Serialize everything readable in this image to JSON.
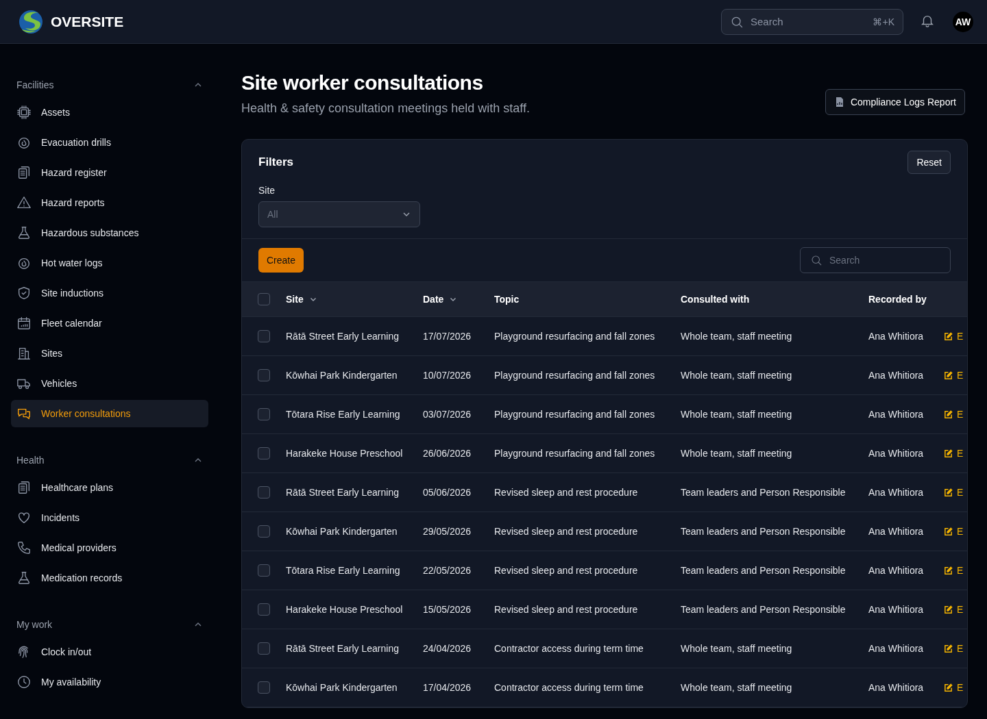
{
  "header": {
    "brand": "OVERSITE",
    "search": {
      "placeholder": "Search",
      "shortcut": "⌘+K"
    },
    "avatar": "AW"
  },
  "sidebar": [
    {
      "title": "Facilities",
      "expanded": true,
      "items": [
        {
          "label": "Assets",
          "selected": false
        },
        {
          "label": "Evacuation drills",
          "selected": false
        },
        {
          "label": "Hazard register",
          "selected": false
        },
        {
          "label": "Hazard reports",
          "selected": false
        },
        {
          "label": "Hazardous substances",
          "selected": false
        },
        {
          "label": "Hot water logs",
          "selected": false
        },
        {
          "label": "Site inductions",
          "selected": false
        },
        {
          "label": "Fleet calendar",
          "selected": false
        },
        {
          "label": "Sites",
          "selected": false
        },
        {
          "label": "Vehicles",
          "selected": false
        },
        {
          "label": "Worker consultations",
          "selected": true
        }
      ]
    },
    {
      "title": "Health",
      "expanded": true,
      "items": [
        {
          "label": "Healthcare plans",
          "selected": false
        },
        {
          "label": "Incidents",
          "selected": false
        },
        {
          "label": "Medical providers",
          "selected": false
        },
        {
          "label": "Medication records",
          "selected": false
        }
      ]
    },
    {
      "title": "My work",
      "expanded": true,
      "items": [
        {
          "label": "Clock in/out",
          "selected": false
        },
        {
          "label": "My availability",
          "selected": false
        }
      ]
    }
  ],
  "page": {
    "title": "Site worker consultations",
    "subtitle": "Health & safety consultation meetings held with staff.",
    "report_button": "Compliance Logs Report"
  },
  "filters": {
    "title": "Filters",
    "reset": "Reset",
    "site_label": "Site",
    "site_value": "All"
  },
  "create_button": "Create",
  "table_search": {
    "placeholder": "Search"
  },
  "table": {
    "select_all_checked": false,
    "columns": [
      {
        "label": "Site",
        "sortable": true
      },
      {
        "label": "Date",
        "sortable": true
      },
      {
        "label": "Topic",
        "sortable": false
      },
      {
        "label": "Consulted with",
        "sortable": false
      },
      {
        "label": "Recorded by",
        "sortable": false
      }
    ],
    "rows": [
      {
        "checked": false,
        "site": "Rātā Street Early Learning",
        "date": "17/07/2026",
        "topic": "Playground resurfacing and fall zones",
        "consulted": "Whole team, staff meeting",
        "recorded_by": "Ana Whitiora",
        "action": "E"
      },
      {
        "checked": false,
        "site": "Kōwhai Park Kindergarten",
        "date": "10/07/2026",
        "topic": "Playground resurfacing and fall zones",
        "consulted": "Whole team, staff meeting",
        "recorded_by": "Ana Whitiora",
        "action": "E"
      },
      {
        "checked": false,
        "site": "Tōtara Rise Early Learning",
        "date": "03/07/2026",
        "topic": "Playground resurfacing and fall zones",
        "consulted": "Whole team, staff meeting",
        "recorded_by": "Ana Whitiora",
        "action": "E"
      },
      {
        "checked": false,
        "site": "Harakeke House Preschool",
        "date": "26/06/2026",
        "topic": "Playground resurfacing and fall zones",
        "consulted": "Whole team, staff meeting",
        "recorded_by": "Ana Whitiora",
        "action": "E"
      },
      {
        "checked": false,
        "site": "Rātā Street Early Learning",
        "date": "05/06/2026",
        "topic": "Revised sleep and rest procedure",
        "consulted": "Team leaders and Person Responsible",
        "recorded_by": "Ana Whitiora",
        "action": "E"
      },
      {
        "checked": false,
        "site": "Kōwhai Park Kindergarten",
        "date": "29/05/2026",
        "topic": "Revised sleep and rest procedure",
        "consulted": "Team leaders and Person Responsible",
        "recorded_by": "Ana Whitiora",
        "action": "E"
      },
      {
        "checked": false,
        "site": "Tōtara Rise Early Learning",
        "date": "22/05/2026",
        "topic": "Revised sleep and rest procedure",
        "consulted": "Team leaders and Person Responsible",
        "recorded_by": "Ana Whitiora",
        "action": "E"
      },
      {
        "checked": false,
        "site": "Harakeke House Preschool",
        "date": "15/05/2026",
        "topic": "Revised sleep and rest procedure",
        "consulted": "Team leaders and Person Responsible",
        "recorded_by": "Ana Whitiora",
        "action": "E"
      },
      {
        "checked": false,
        "site": "Rātā Street Early Learning",
        "date": "24/04/2026",
        "topic": "Contractor access during term time",
        "consulted": "Whole team, staff meeting",
        "recorded_by": "Ana Whitiora",
        "action": "E"
      },
      {
        "checked": false,
        "site": "Kōwhai Park Kindergarten",
        "date": "17/04/2026",
        "topic": "Contractor access during term time",
        "consulted": "Whole team, staff meeting",
        "recorded_by": "Ana Whitiora",
        "action": "E"
      }
    ]
  }
}
